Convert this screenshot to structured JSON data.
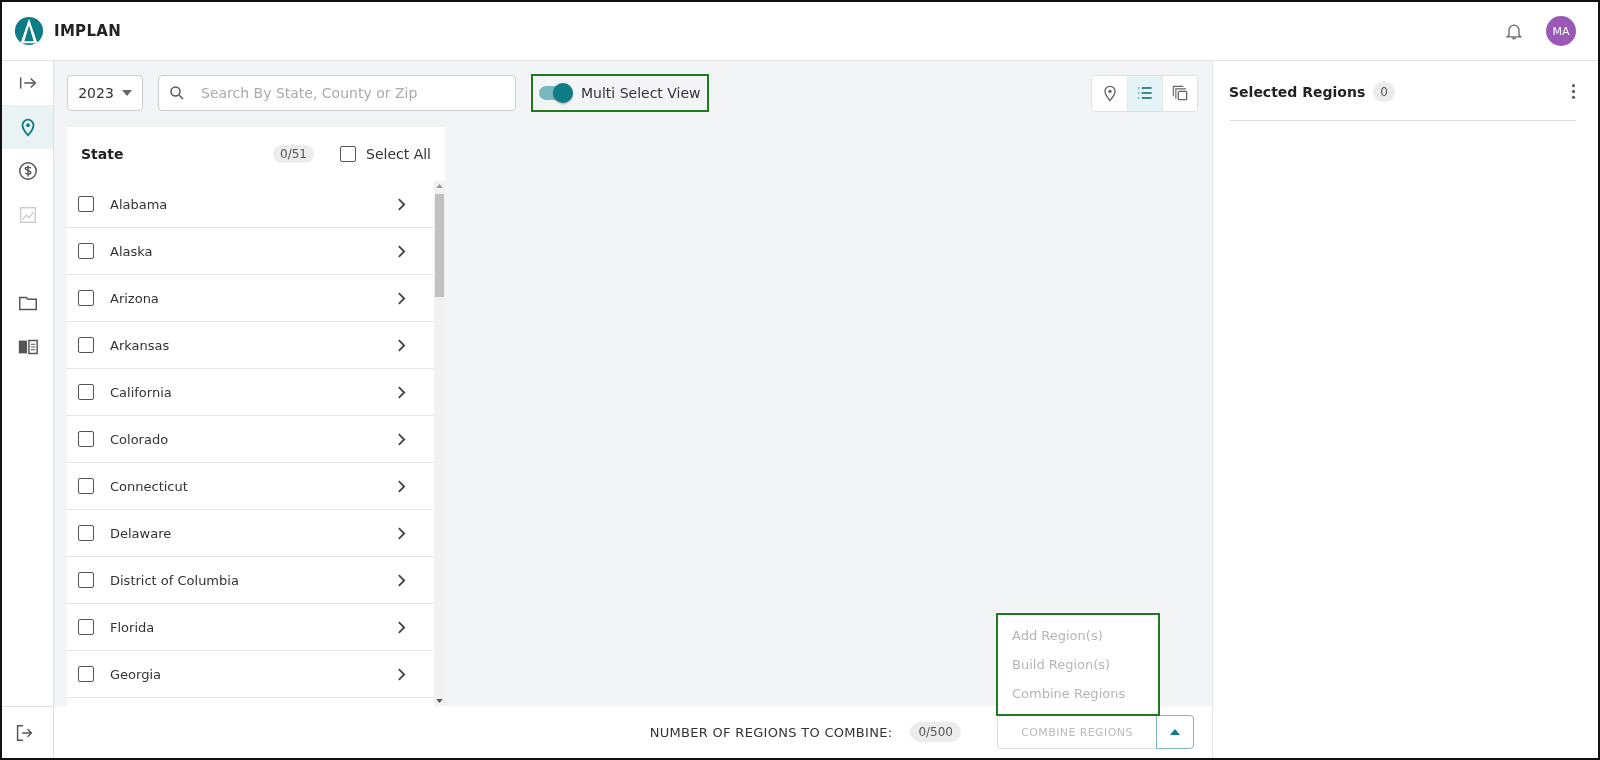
{
  "header": {
    "app_name": "IMPLAN",
    "avatar_initials": "MA"
  },
  "nav": [
    {
      "kind": "expand",
      "selected": false,
      "disabled": false
    },
    {
      "kind": "location",
      "selected": true,
      "disabled": false
    },
    {
      "kind": "dollar",
      "selected": false,
      "disabled": false
    },
    {
      "kind": "chart",
      "selected": false,
      "disabled": true
    },
    {
      "kind": "folder",
      "selected": false,
      "disabled": false
    },
    {
      "kind": "book",
      "selected": false,
      "disabled": false
    }
  ],
  "toolbar": {
    "year": "2023",
    "search": {
      "placeholder": "Search By State, County or Zip"
    },
    "multi_select": {
      "label": "Multi Select View",
      "on": true
    },
    "views": [
      {
        "kind": "map",
        "selected": false
      },
      {
        "kind": "list",
        "selected": true
      },
      {
        "kind": "copy",
        "selected": false
      }
    ]
  },
  "state_panel": {
    "title": "State",
    "count": "0/51",
    "select_all": {
      "label": "Select All",
      "checked": false
    },
    "rows": [
      {
        "name": "Alabama",
        "checked": false
      },
      {
        "name": "Alaska",
        "checked": false
      },
      {
        "name": "Arizona",
        "checked": false
      },
      {
        "name": "Arkansas",
        "checked": false
      },
      {
        "name": "California",
        "checked": false
      },
      {
        "name": "Colorado",
        "checked": false
      },
      {
        "name": "Connecticut",
        "checked": false
      },
      {
        "name": "Delaware",
        "checked": false
      },
      {
        "name": "District of Columbia",
        "checked": false
      },
      {
        "name": "Florida",
        "checked": false
      },
      {
        "name": "Georgia",
        "checked": false
      }
    ]
  },
  "menu": [
    {
      "label": "Add Region(s)",
      "disabled": true
    },
    {
      "label": "Build Region(s)",
      "disabled": true
    },
    {
      "label": "Combine Regions",
      "disabled": true
    }
  ],
  "bottom_bar": {
    "label": "NUMBER OF REGIONS TO COMBINE:",
    "count": "0/500",
    "button": {
      "label": "COMBINE REGIONS",
      "disabled": true
    }
  },
  "selected_regions": {
    "title": "Selected Regions",
    "count": "0"
  }
}
